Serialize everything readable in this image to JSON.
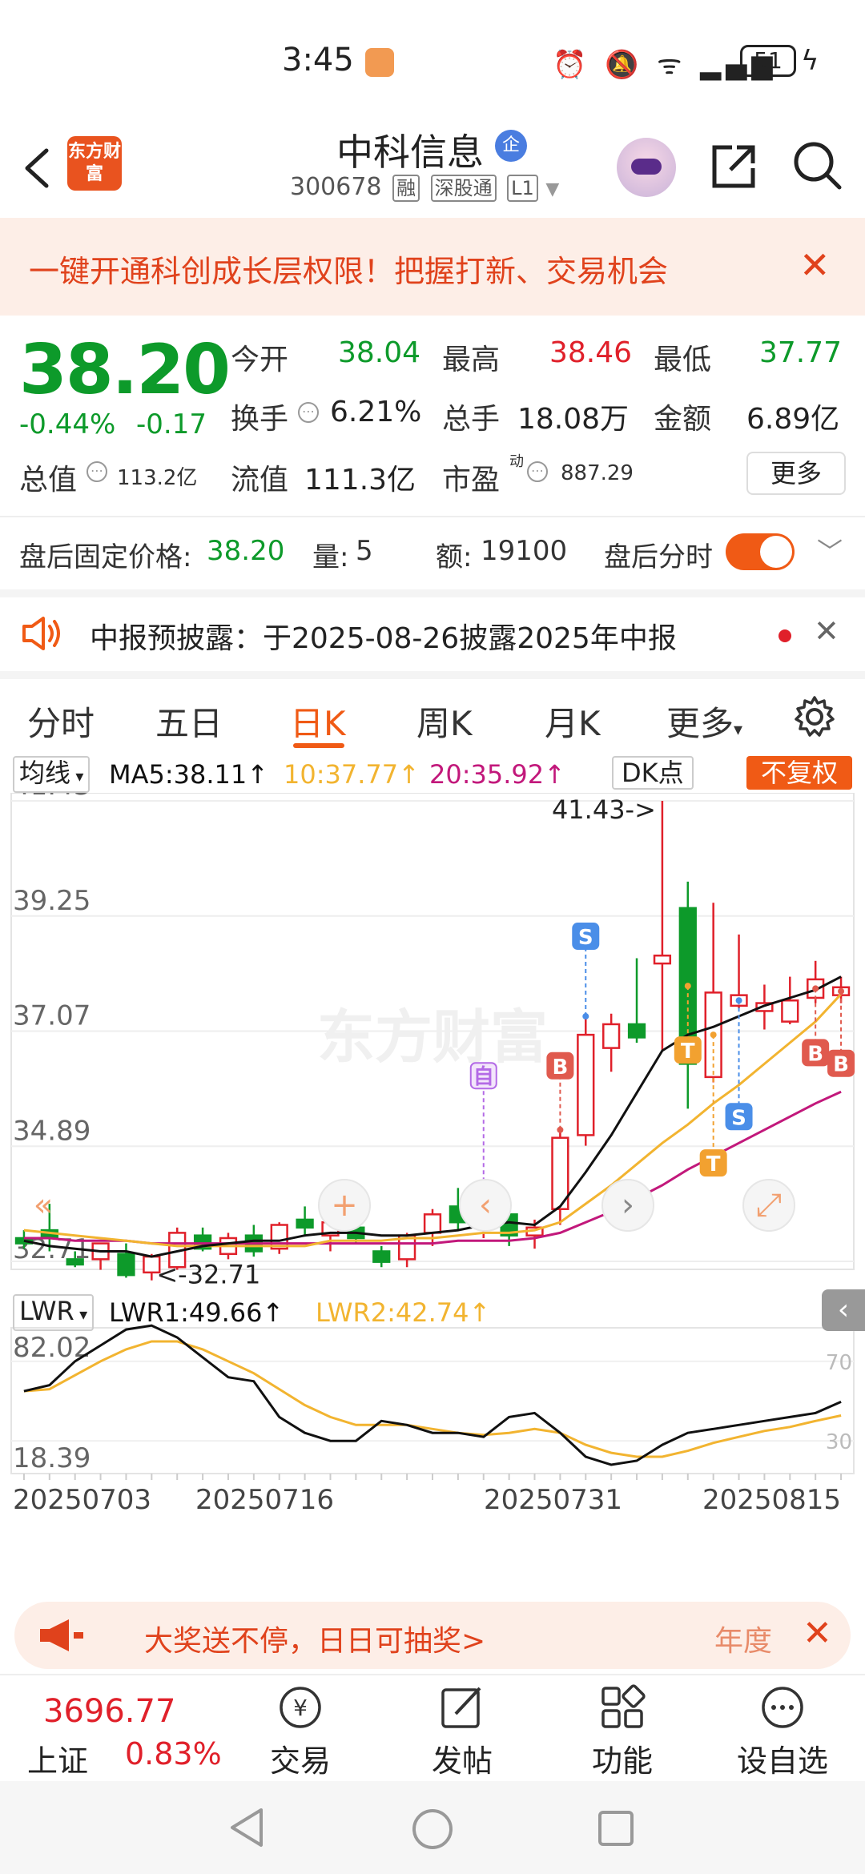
{
  "status_bar": {
    "time": "3:45",
    "battery": "51"
  },
  "header": {
    "logo": "东方财富",
    "stock_name": "中科信息",
    "badge": "企",
    "code": "300678",
    "tags": [
      "融",
      "深股通",
      "L1"
    ]
  },
  "promo": {
    "text": "一键开通科创成长层权限！把握打新、交易机会",
    "close": "✕"
  },
  "quote": {
    "price": "38.20",
    "change_pct": "-0.44%",
    "change_abs": "-0.17",
    "fields": {
      "open_label": "今开",
      "open": "38.04",
      "high_label": "最高",
      "high": "38.46",
      "low_label": "最低",
      "low": "37.77",
      "turnover_label": "换手",
      "turnover": "6.21%",
      "volume_label": "总手",
      "volume": "18.08万",
      "amount_label": "金额",
      "amount": "6.89亿",
      "mktcap_label": "总值",
      "mktcap": "113.2亿",
      "float_label": "流值",
      "float": "111.3亿",
      "pe_label": "市盈",
      "pe_sup": "动",
      "pe": "887.29"
    },
    "more": "更多"
  },
  "after_hours": {
    "price_label": "盘后固定价格:",
    "price": "38.20",
    "vol_label": "量:",
    "vol": "5",
    "amt_label": "额:",
    "amt": "19100",
    "toggle_label": "盘后分时"
  },
  "announcement": {
    "text": "中报预披露：于2025-08-26披露2025年中报",
    "close": "✕"
  },
  "tabs": [
    "分时",
    "五日",
    "日K",
    "周K",
    "月K",
    "更多"
  ],
  "ma_bar": {
    "selector": "均线",
    "ma5": "MA5:38.11↑",
    "ma10": "10:37.77↑",
    "ma20": "20:35.92↑",
    "dk": "DK点",
    "fq": "不复权"
  },
  "lwr_bar": {
    "selector": "LWR",
    "lwr1": "LWR1:49.66↑",
    "lwr2": "LWR2:42.74↑",
    "side": "‹"
  },
  "colors": {
    "up": "#e0202a",
    "down": "#0d9a2a",
    "accent": "#f05a15",
    "ma5": "#111111",
    "ma10": "#f2b430",
    "ma20": "#c2187b"
  },
  "chart_data": {
    "type": "candlestick",
    "y_labels": [
      "41.43",
      "39.25",
      "37.07",
      "34.89",
      "32.71"
    ],
    "ylim": [
      32.71,
      41.43
    ],
    "max_annotation": "41.43->",
    "min_annotation": "<-32.71",
    "x_labels": [
      "20250703",
      "20250716",
      "20250731",
      "20250815"
    ],
    "watermark": "东方财富",
    "markers": [
      "自",
      "S",
      "B",
      "T",
      "T",
      "S",
      "B",
      "B"
    ],
    "candles": [
      {
        "o": 33.15,
        "h": 33.3,
        "l": 32.95,
        "c": 33.05
      },
      {
        "o": 33.3,
        "h": 33.8,
        "l": 32.9,
        "c": 33.15
      },
      {
        "o": 32.75,
        "h": 32.9,
        "l": 32.6,
        "c": 32.65
      },
      {
        "o": 32.75,
        "h": 33.05,
        "l": 32.55,
        "c": 33.05
      },
      {
        "o": 32.85,
        "h": 33.05,
        "l": 32.4,
        "c": 32.45
      },
      {
        "o": 32.5,
        "h": 32.85,
        "l": 32.35,
        "c": 32.8
      },
      {
        "o": 32.6,
        "h": 33.35,
        "l": 32.55,
        "c": 33.25
      },
      {
        "o": 33.2,
        "h": 33.35,
        "l": 32.9,
        "c": 32.95
      },
      {
        "o": 32.85,
        "h": 33.25,
        "l": 32.75,
        "c": 33.15
      },
      {
        "o": 33.2,
        "h": 33.4,
        "l": 32.8,
        "c": 32.9
      },
      {
        "o": 32.95,
        "h": 33.45,
        "l": 32.85,
        "c": 33.4
      },
      {
        "o": 33.5,
        "h": 33.75,
        "l": 33.2,
        "c": 33.35
      },
      {
        "o": 33.2,
        "h": 33.6,
        "l": 32.9,
        "c": 33.45
      },
      {
        "o": 33.35,
        "h": 33.45,
        "l": 33.05,
        "c": 33.15
      },
      {
        "o": 32.9,
        "h": 33.0,
        "l": 32.6,
        "c": 32.7
      },
      {
        "o": 32.75,
        "h": 33.25,
        "l": 32.6,
        "c": 33.2
      },
      {
        "o": 33.25,
        "h": 33.7,
        "l": 33.0,
        "c": 33.6
      },
      {
        "o": 33.75,
        "h": 34.1,
        "l": 33.3,
        "c": 33.45
      },
      {
        "o": 33.45,
        "h": 33.95,
        "l": 33.15,
        "c": 33.7
      },
      {
        "o": 33.6,
        "h": 33.8,
        "l": 33.0,
        "c": 33.2
      },
      {
        "o": 33.2,
        "h": 33.5,
        "l": 32.95,
        "c": 33.35
      },
      {
        "o": 33.7,
        "h": 35.2,
        "l": 33.4,
        "c": 35.05
      },
      {
        "o": 35.1,
        "h": 37.35,
        "l": 34.9,
        "c": 37.0
      },
      {
        "o": 36.75,
        "h": 37.4,
        "l": 36.3,
        "c": 37.2
      },
      {
        "o": 37.2,
        "h": 38.45,
        "l": 36.85,
        "c": 36.95
      },
      {
        "o": 38.35,
        "h": 41.43,
        "l": 36.7,
        "c": 38.5
      },
      {
        "o": 39.4,
        "h": 39.9,
        "l": 35.6,
        "c": 36.45
      },
      {
        "o": 36.2,
        "h": 39.5,
        "l": 36.1,
        "c": 37.8
      },
      {
        "o": 37.55,
        "h": 38.9,
        "l": 37.5,
        "c": 37.75
      },
      {
        "o": 37.45,
        "h": 37.95,
        "l": 37.1,
        "c": 37.6
      },
      {
        "o": 37.25,
        "h": 38.1,
        "l": 37.2,
        "c": 37.65
      },
      {
        "o": 37.7,
        "h": 38.4,
        "l": 37.6,
        "c": 38.05
      },
      {
        "o": 37.75,
        "h": 38.1,
        "l": 37.6,
        "c": 37.9
      }
    ],
    "ma5": [
      33.1,
      33.0,
      32.95,
      32.9,
      32.9,
      32.8,
      32.9,
      33.0,
      33.05,
      33.1,
      33.1,
      33.2,
      33.25,
      33.25,
      33.2,
      33.2,
      33.25,
      33.3,
      33.4,
      33.45,
      33.4,
      33.75,
      34.4,
      35.1,
      35.9,
      36.7,
      37.0,
      37.15,
      37.35,
      37.55,
      37.7,
      37.85,
      38.1
    ],
    "ma10": [
      33.3,
      33.25,
      33.2,
      33.15,
      33.1,
      33.05,
      33.0,
      33.0,
      33.0,
      33.0,
      33.0,
      33.0,
      33.1,
      33.1,
      33.1,
      33.15,
      33.15,
      33.2,
      33.25,
      33.25,
      33.3,
      33.45,
      33.8,
      34.15,
      34.55,
      34.95,
      35.3,
      35.7,
      36.05,
      36.45,
      36.85,
      37.25,
      37.77
    ],
    "ma20": [
      33.15,
      33.15,
      33.1,
      33.1,
      33.1,
      33.05,
      33.05,
      33.05,
      33.05,
      33.05,
      33.05,
      33.05,
      33.05,
      33.05,
      33.05,
      33.05,
      33.05,
      33.1,
      33.1,
      33.1,
      33.15,
      33.25,
      33.45,
      33.65,
      33.9,
      34.15,
      34.45,
      34.7,
      34.95,
      35.2,
      35.45,
      35.7,
      35.92
    ],
    "lwr": {
      "y_labels": [
        "82.02",
        "18.39"
      ],
      "right_labels": [
        "70",
        "30"
      ],
      "ylim": [
        18.39,
        82.02
      ],
      "lwr1": [
        55,
        58,
        70,
        78,
        86,
        88,
        82,
        72,
        62,
        60,
        42,
        34,
        30,
        30,
        40,
        38,
        34,
        34,
        32,
        42,
        44,
        34,
        22,
        18,
        20,
        28,
        34,
        36,
        38,
        40,
        42,
        44,
        49.66
      ],
      "lwr2": [
        55,
        56,
        63,
        70,
        76,
        80,
        80,
        76,
        70,
        64,
        56,
        48,
        42,
        38,
        38,
        38,
        36,
        34,
        33,
        34,
        36,
        34,
        28,
        24,
        22,
        22,
        25,
        29,
        32,
        35,
        37,
        40,
        42.74
      ]
    }
  },
  "lottery": {
    "text": "大奖送不停，日日可抽奖>",
    "tail": "年度",
    "close": "✕"
  },
  "bottom_nav": {
    "index_value": "3696.77",
    "index_name": "上证",
    "index_pct": "0.83%",
    "items": [
      "交易",
      "发帖",
      "功能",
      "设自选"
    ]
  }
}
